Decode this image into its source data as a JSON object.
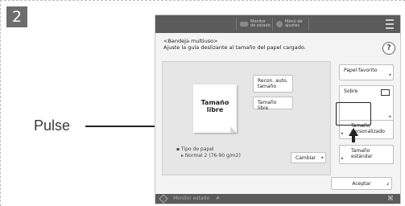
{
  "step": "2",
  "callout": "Pulse",
  "topbar": {
    "item1": "Monitor de estado",
    "item2": "Menú de ajustes"
  },
  "header": {
    "line1": "<Bandeja multiuso>",
    "line2": "Ajuste la guía deslizante al tamaño del papel cargado."
  },
  "help_label": "?",
  "paper": {
    "line1": "Tamaño",
    "line2": "libre"
  },
  "buttons": {
    "recon_line1": "Recon. auto.",
    "recon_line2": "tamaño",
    "tamano_libre": "Tamaño libre",
    "papel_favorito": "Papel favorito",
    "sobre": "Sobre",
    "personalizado_line1": "Tamaño",
    "personalizado_line2": "personalizado",
    "estandar_line1": "Tamaño",
    "estandar_line2": "estándar",
    "cambiar": "Cambiar",
    "aceptar": "Aceptar"
  },
  "tipo": {
    "label": "Tipo de papel",
    "value": "Normal 2 (76-90 g/m2)"
  },
  "footer": {
    "status": "Monitor estado"
  }
}
